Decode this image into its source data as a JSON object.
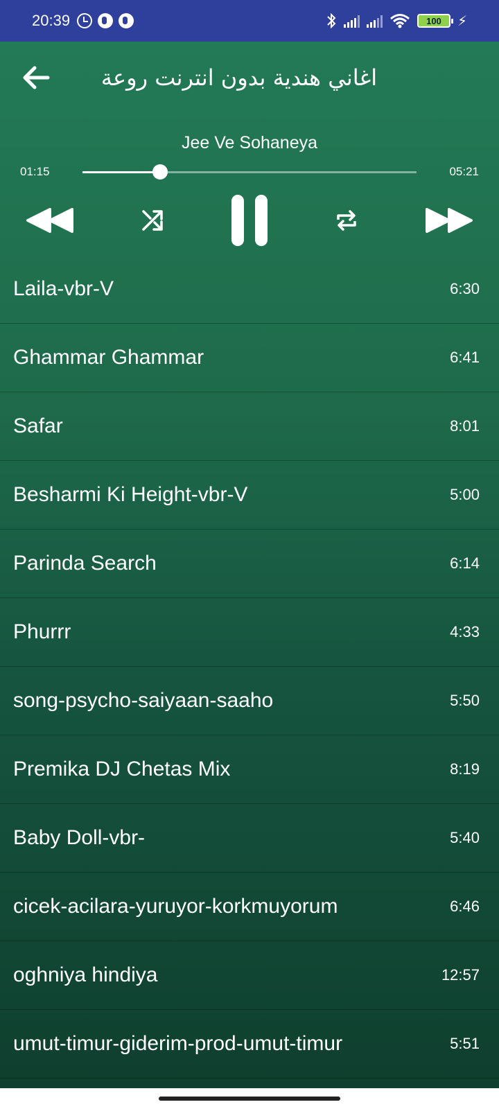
{
  "status_bar": {
    "time": "20:39",
    "battery": "100",
    "icons": [
      "alarm-icon",
      "app-notification-icon",
      "app-notification-icon",
      "bluetooth-icon",
      "signal-icon",
      "signal-icon",
      "wifi-icon",
      "battery-icon",
      "charging-icon"
    ]
  },
  "header": {
    "back_icon": "back-arrow-icon",
    "title": "اغاني هندية بدون انترنت روعة"
  },
  "player": {
    "current_title": "Jee Ve Sohaneya",
    "elapsed": "01:15",
    "total": "05:21",
    "progress_fraction": 0.233,
    "controls": [
      "rewind-icon",
      "shuffle-icon",
      "pause-icon",
      "repeat-icon",
      "fast-forward-icon"
    ]
  },
  "songs": [
    {
      "name": "Laila-vbr-V",
      "duration": "6:30"
    },
    {
      "name": "Ghammar Ghammar",
      "duration": "6:41"
    },
    {
      "name": "Safar",
      "duration": "8:01"
    },
    {
      "name": "Besharmi Ki Height-vbr-V",
      "duration": "5:00"
    },
    {
      "name": "Parinda Search",
      "duration": "6:14"
    },
    {
      "name": "Phurrr",
      "duration": "4:33"
    },
    {
      "name": "song-psycho-saiyaan-saaho",
      "duration": "5:50"
    },
    {
      "name": "Premika DJ Chetas Mix",
      "duration": "8:19"
    },
    {
      "name": "Baby Doll-vbr-",
      "duration": "5:40"
    },
    {
      "name": "cicek-acilara-yuruyor-korkmuyorum",
      "duration": "6:46"
    },
    {
      "name": "oghniya hindiya",
      "duration": "12:57"
    },
    {
      "name": "umut-timur-giderim-prod-umut-timur",
      "duration": "5:51"
    }
  ]
}
